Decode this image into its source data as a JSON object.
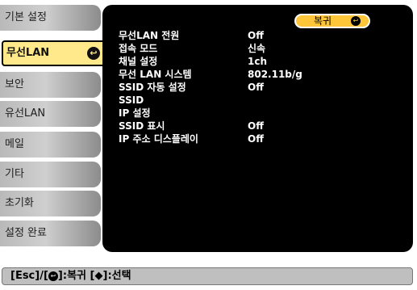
{
  "sidebar": {
    "items": [
      {
        "label": "기본 설정"
      },
      {
        "label": "무선LAN"
      },
      {
        "label": "보안"
      },
      {
        "label": "유선LAN"
      },
      {
        "label": "메일"
      },
      {
        "label": "기타"
      },
      {
        "label": "초기화"
      },
      {
        "label": "설정 완료"
      }
    ]
  },
  "main": {
    "return_label": "복귀",
    "settings": [
      {
        "label": "무선LAN 전원",
        "value": "Off"
      },
      {
        "label": "접속 모드",
        "value": "신속"
      },
      {
        "label": "채널 설정",
        "value": "1ch"
      },
      {
        "label": "무선 LAN 시스템",
        "value": "802.11b/g"
      },
      {
        "label": "SSID 자동 설정",
        "value": "Off"
      },
      {
        "label": "SSID",
        "value": ""
      },
      {
        "label": "IP 설정",
        "value": ""
      },
      {
        "label": "SSID 표시",
        "value": "Off"
      },
      {
        "label": "IP 주소 디스플레이",
        "value": "Off"
      }
    ]
  },
  "footer": {
    "esc": "[Esc]",
    "slash": "/[",
    "close": "]",
    "return_text": ":복귀",
    "select_open": "[",
    "select_arrow": "◆",
    "select_close": "]",
    "select_text": ":선택"
  }
}
